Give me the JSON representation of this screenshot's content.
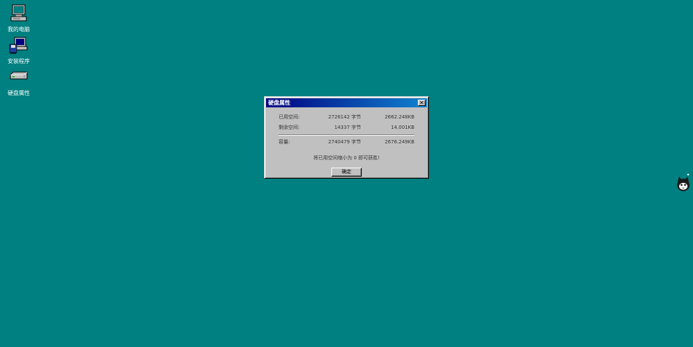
{
  "desktop": {
    "icons": [
      {
        "label": "我的电脑",
        "icon": "my-computer-icon"
      },
      {
        "label": "安装程序",
        "icon": "setup-icon"
      },
      {
        "label": "硬盘属性",
        "icon": "hard-disk-icon"
      }
    ]
  },
  "dialog": {
    "title": "硬盘属性",
    "close_glyph": "✕",
    "rows": [
      {
        "label": "已用空间:",
        "bytes": "2726142 字节",
        "kb": "2662.248KB"
      },
      {
        "label": "剩余空间:",
        "bytes": "14337 字节",
        "kb": "14.001KB"
      },
      {
        "label": "容量:",
        "bytes": "2740479 字节",
        "kb": "2676.249KB"
      }
    ],
    "message": "将已用空间缩小为 0 即可获胜!",
    "ok_label": "确定"
  },
  "mascot": {
    "icon": "cat-mascot-icon"
  },
  "colors": {
    "desktop_bg": "#008080",
    "title_start": "#000080",
    "title_end": "#1084d0",
    "window_face": "#c0c0c0"
  }
}
